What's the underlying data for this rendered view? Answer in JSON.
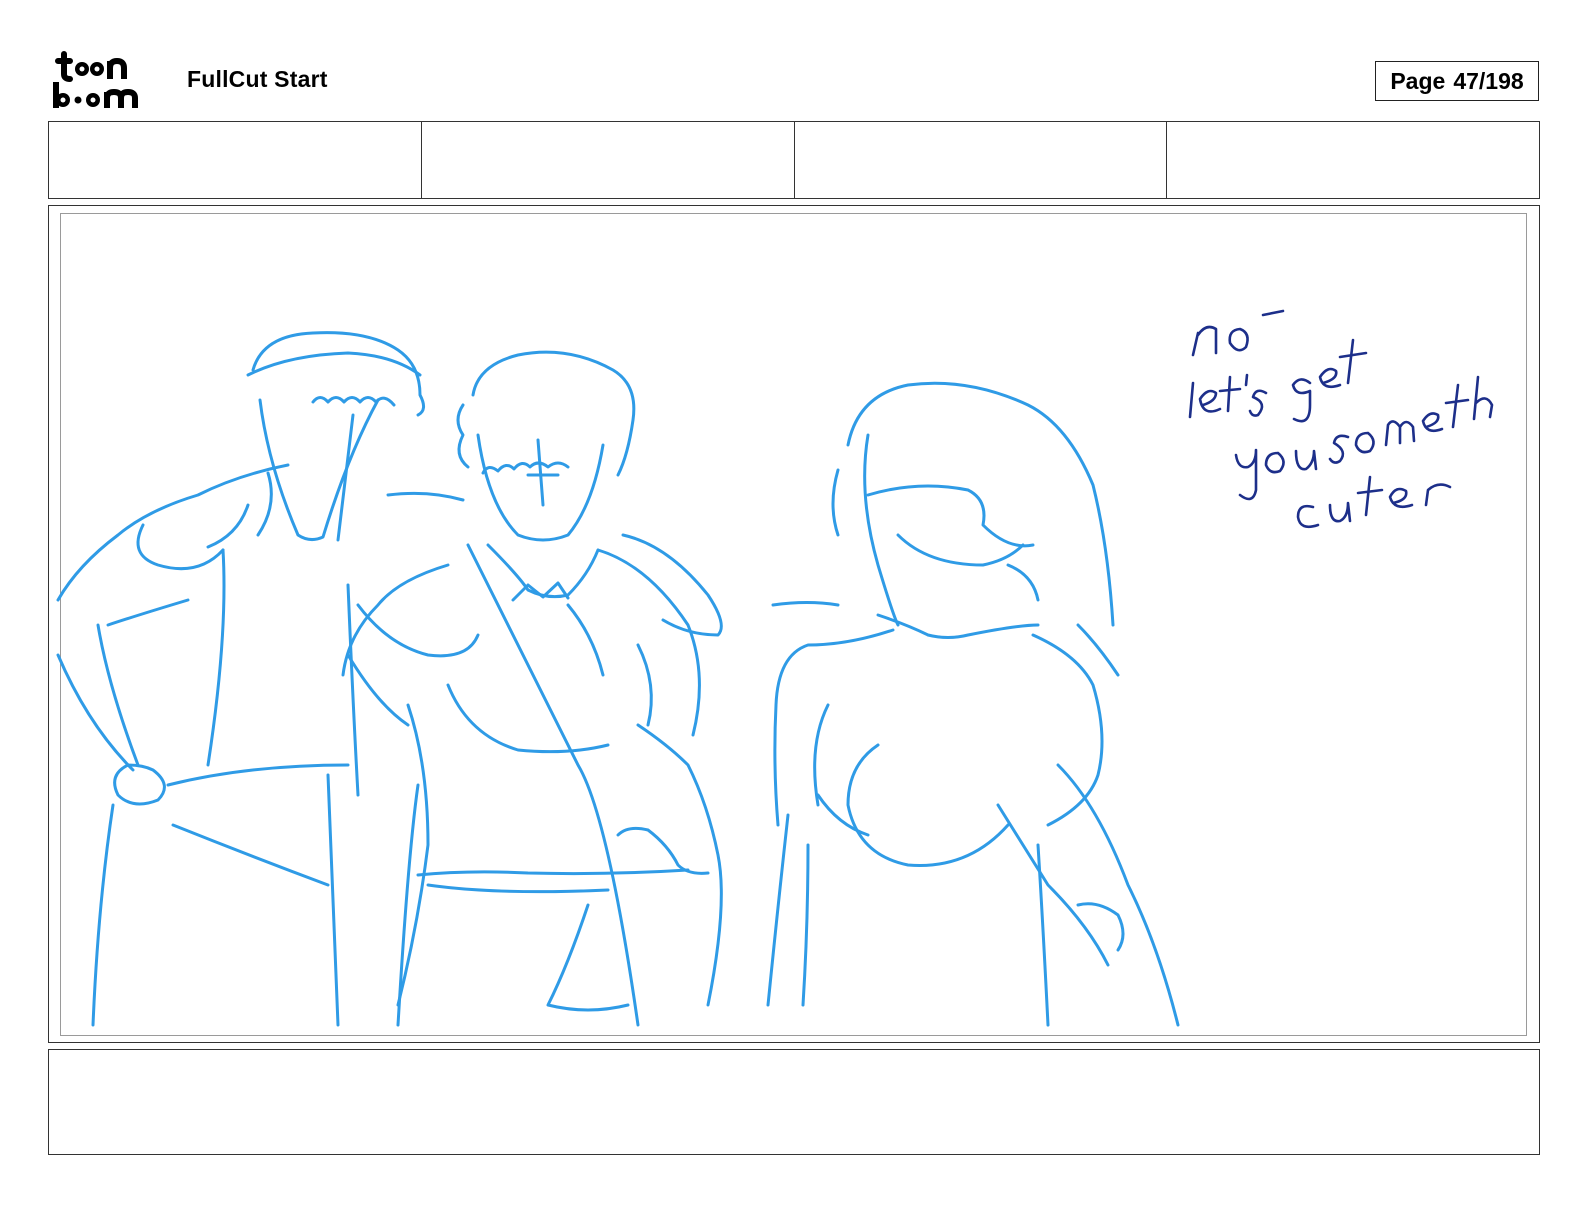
{
  "header": {
    "logo_text": "toon boom",
    "project_title": "FullCut Start",
    "page_label": "Page",
    "page_number": "47/198"
  },
  "meta_fields": [
    "",
    "",
    "",
    ""
  ],
  "panel": {
    "handwritten_note": "no - let's get you someth cuter",
    "sketch_color": "#2f9be6",
    "note_color": "#1d2f8a"
  },
  "notes": {
    "text": ""
  }
}
